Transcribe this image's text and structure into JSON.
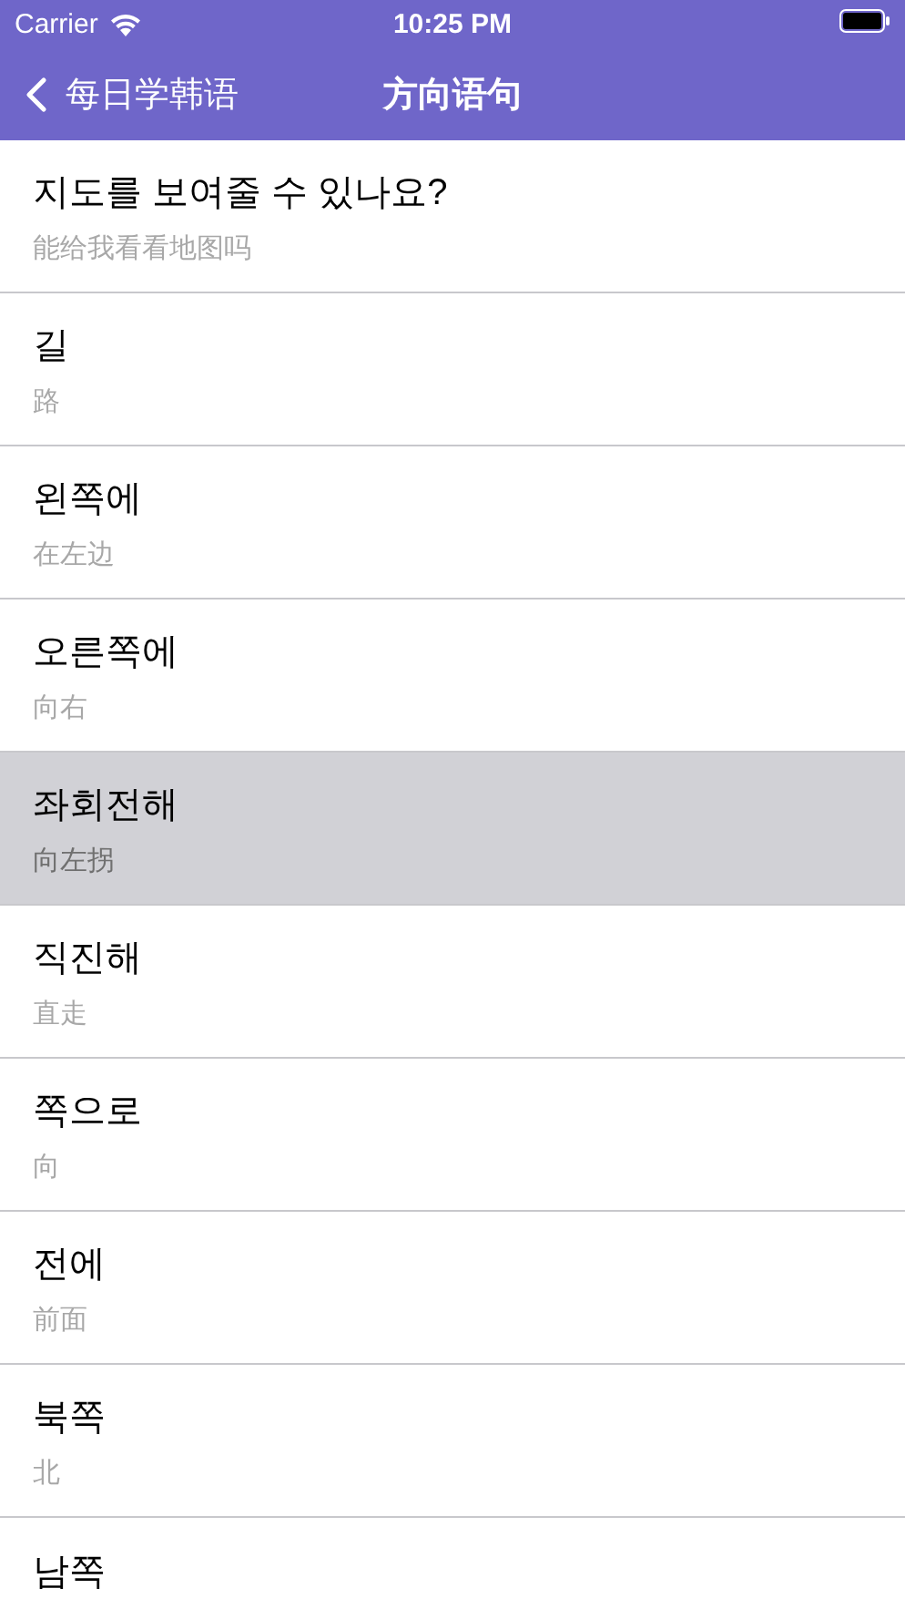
{
  "status_bar": {
    "carrier": "Carrier",
    "time": "10:25 PM"
  },
  "nav_bar": {
    "back_label": "每日学韩语",
    "title": "方向语句"
  },
  "phrases": [
    {
      "korean": "지도를 보여줄 수 있나요?",
      "chinese": "能给我看看地图吗",
      "selected": false
    },
    {
      "korean": "길",
      "chinese": "路",
      "selected": false
    },
    {
      "korean": "왼쪽에",
      "chinese": "在左边",
      "selected": false
    },
    {
      "korean": "오른쪽에",
      "chinese": "向右",
      "selected": false
    },
    {
      "korean": "좌회전해",
      "chinese": "向左拐",
      "selected": true
    },
    {
      "korean": "직진해",
      "chinese": "直走",
      "selected": false
    },
    {
      "korean": "쪽으로",
      "chinese": "向",
      "selected": false
    },
    {
      "korean": "전에",
      "chinese": "前面",
      "selected": false
    },
    {
      "korean": "북쪽",
      "chinese": "北",
      "selected": false
    },
    {
      "korean": "남쪽",
      "selected": false
    }
  ]
}
